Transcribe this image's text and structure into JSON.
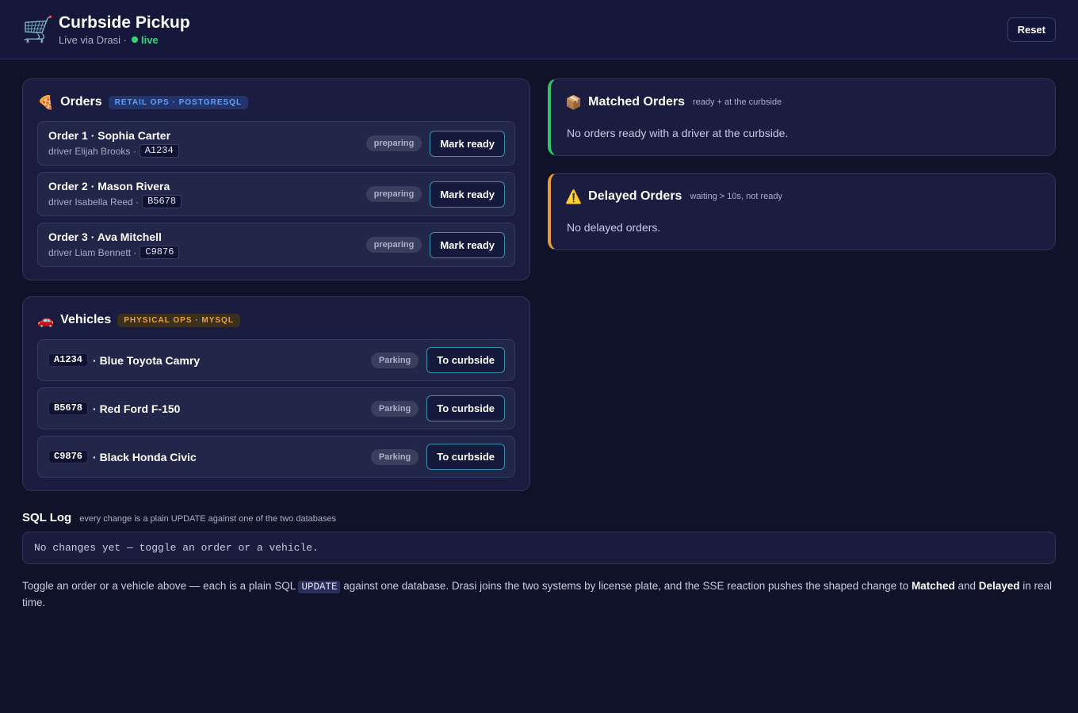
{
  "header": {
    "app_icon": "shopping-cart-icon",
    "title": "Curbside Pickup",
    "subtitle": "Live via Drasi ·",
    "live_label": "live",
    "reset_label": "Reset"
  },
  "orders": {
    "icon": "pizza-icon",
    "title": "Orders",
    "badge": "RETAIL OPS · POSTGRESQL",
    "items": [
      {
        "title": "Order 1 · Sophia Carter",
        "driver": "driver Elijah Brooks ·",
        "plate": "A1234",
        "status": "preparing",
        "action": "Mark ready"
      },
      {
        "title": "Order 2 · Mason Rivera",
        "driver": "driver Isabella Reed ·",
        "plate": "B5678",
        "status": "preparing",
        "action": "Mark ready"
      },
      {
        "title": "Order 3 · Ava Mitchell",
        "driver": "driver Liam Bennett ·",
        "plate": "C9876",
        "status": "preparing",
        "action": "Mark ready"
      }
    ]
  },
  "vehicles": {
    "icon": "car-icon",
    "title": "Vehicles",
    "badge": "PHYSICAL OPS · MYSQL",
    "items": [
      {
        "plate": "A1234",
        "name": "· Blue Toyota Camry",
        "status": "Parking",
        "action": "To curbside"
      },
      {
        "plate": "B5678",
        "name": "· Red Ford F-150",
        "status": "Parking",
        "action": "To curbside"
      },
      {
        "plate": "C9876",
        "name": "· Black Honda Civic",
        "status": "Parking",
        "action": "To curbside"
      }
    ]
  },
  "matched": {
    "icon": "package-icon",
    "title": "Matched Orders",
    "hint": "ready + at the curbside",
    "empty": "No orders ready with a driver at the curbside."
  },
  "delayed": {
    "icon": "warning-icon",
    "title": "Delayed Orders",
    "hint": "waiting > 10s, not ready",
    "empty": "No delayed orders."
  },
  "sql_log": {
    "title": "SQL Log",
    "hint": "every change is a plain UPDATE against one of the two databases",
    "empty": "No changes yet — toggle an order or a vehicle."
  },
  "footer": {
    "part1": "Toggle an order or a vehicle above — each is a plain SQL ",
    "code": "UPDATE",
    "part2": " against one database. Drasi joins the two systems by license plate, and the SSE reaction pushes the shaped change to ",
    "matched": "Matched",
    "and": " and ",
    "delayed": "Delayed",
    "part3": " in real time."
  },
  "colors": {
    "background": "#10122a",
    "live": "#34d27a",
    "matched_accent": "#34c26a",
    "delayed_accent": "#e99a3a",
    "button_border": "#3b8fb0"
  }
}
